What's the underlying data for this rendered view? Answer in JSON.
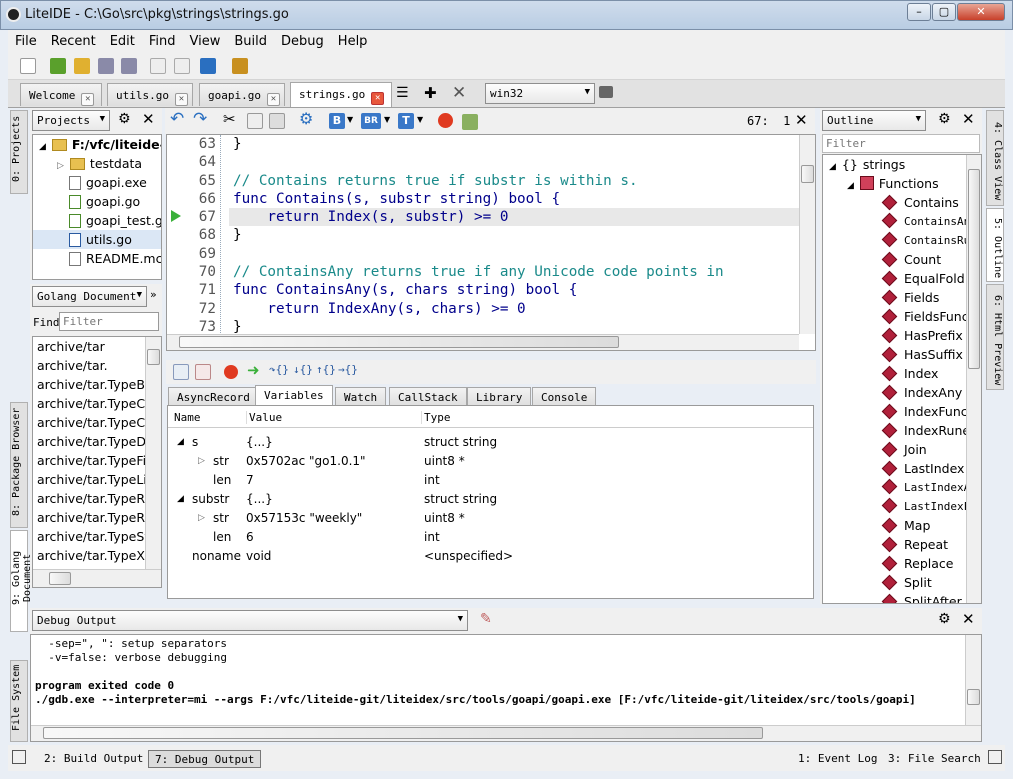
{
  "window": {
    "title": "LiteIDE - C:\\Go\\src\\pkg\\strings\\strings.go"
  },
  "menu": [
    "File",
    "Recent",
    "Edit",
    "Find",
    "View",
    "Build",
    "Debug",
    "Help"
  ],
  "tabs": [
    {
      "label": "Welcome"
    },
    {
      "label": "utils.go"
    },
    {
      "label": "goapi.go"
    },
    {
      "label": "strings.go"
    }
  ],
  "env_combo": "win32",
  "projects": {
    "combo": "Projects",
    "root": "F:/vfc/liteide-g",
    "items": [
      "testdata",
      "goapi.exe",
      "goapi.go",
      "goapi_test.g",
      "utils.go",
      "README.mc"
    ]
  },
  "package_browser": {
    "combo": "Golang Document",
    "find_label": "Find",
    "filter_placeholder": "Filter",
    "items": [
      "archive/tar",
      "archive/tar.",
      "archive/tar.TypeBlc",
      "archive/tar.TypeCh",
      "archive/tar.TypeCo",
      "archive/tar.TypeDir",
      "archive/tar.TypeFifc",
      "archive/tar.TypeLin",
      "archive/tar.TypeReg",
      "archive/tar.TypeReg",
      "archive/tar.TypeSyn",
      "archive/tar.TypeXG"
    ]
  },
  "editor": {
    "cursor": "67:  1",
    "lines": [
      {
        "n": "63",
        "code": "}"
      },
      {
        "n": "64",
        "code": ""
      },
      {
        "n": "65",
        "code": "// Contains returns true if substr is within s."
      },
      {
        "n": "66",
        "code": "func Contains(s, substr string) bool {"
      },
      {
        "n": "67",
        "code": "    return Index(s, substr) >= 0"
      },
      {
        "n": "68",
        "code": "}"
      },
      {
        "n": "69",
        "code": ""
      },
      {
        "n": "70",
        "code": "// ContainsAny returns true if any Unicode code points in"
      },
      {
        "n": "71",
        "code": "func ContainsAny(s, chars string) bool {"
      },
      {
        "n": "72",
        "code": "    return IndexAny(s, chars) >= 0"
      },
      {
        "n": "73",
        "code": "}"
      }
    ]
  },
  "debug_tabs": [
    "AsyncRecord",
    "Variables",
    "Watch",
    "CallStack",
    "Library",
    "Console"
  ],
  "variables": {
    "headers": [
      "Name",
      "Value",
      "Type"
    ],
    "rows": [
      {
        "name": "s",
        "value": "{...}",
        "type": "struct string"
      },
      {
        "name": "str",
        "value": "0x5702ac \"go1.0.1\"",
        "type": "uint8 *"
      },
      {
        "name": "len",
        "value": "7",
        "type": "int"
      },
      {
        "name": "substr",
        "value": "{...}",
        "type": "struct string"
      },
      {
        "name": "str",
        "value": "0x57153c \"weekly\"",
        "type": "uint8 *"
      },
      {
        "name": "len",
        "value": "6",
        "type": "int"
      },
      {
        "name": "noname",
        "value": "void",
        "type": "<unspecified>"
      }
    ]
  },
  "outline": {
    "combo": "Outline",
    "filter_placeholder": "Filter",
    "root": "strings",
    "group": "Functions",
    "items": [
      "Contains",
      "ContainsAny",
      "ContainsRur",
      "Count",
      "EqualFold",
      "Fields",
      "FieldsFunc",
      "HasPrefix",
      "HasSuffix",
      "Index",
      "IndexAny",
      "IndexFunc",
      "IndexRune",
      "Join",
      "LastIndex",
      "LastIndexAr",
      "LastIndexFu",
      "Map",
      "Repeat",
      "Replace",
      "Split",
      "SplitAfter"
    ]
  },
  "debug_output": {
    "combo": "Debug Output",
    "lines": [
      "  -sep=\", \": setup separators",
      "  -v=false: verbose debugging",
      "",
      "program exited code 0",
      "./gdb.exe --interpreter=mi --args F:/vfc/liteide-git/liteidex/src/tools/goapi/goapi.exe [F:/vfc/liteide-git/liteidex/src/tools/goapi]"
    ]
  },
  "left_sidetabs": [
    "0: Projects",
    "8: Package Browser",
    "9: Golang Document",
    "File System"
  ],
  "right_sidetabs": [
    "4: Class View",
    "5: Outline",
    "6: Html Preview"
  ],
  "status": {
    "build": "2: Build Output",
    "debug": "7: Debug Output",
    "event": "1: Event Log",
    "search": "3: File Search"
  }
}
